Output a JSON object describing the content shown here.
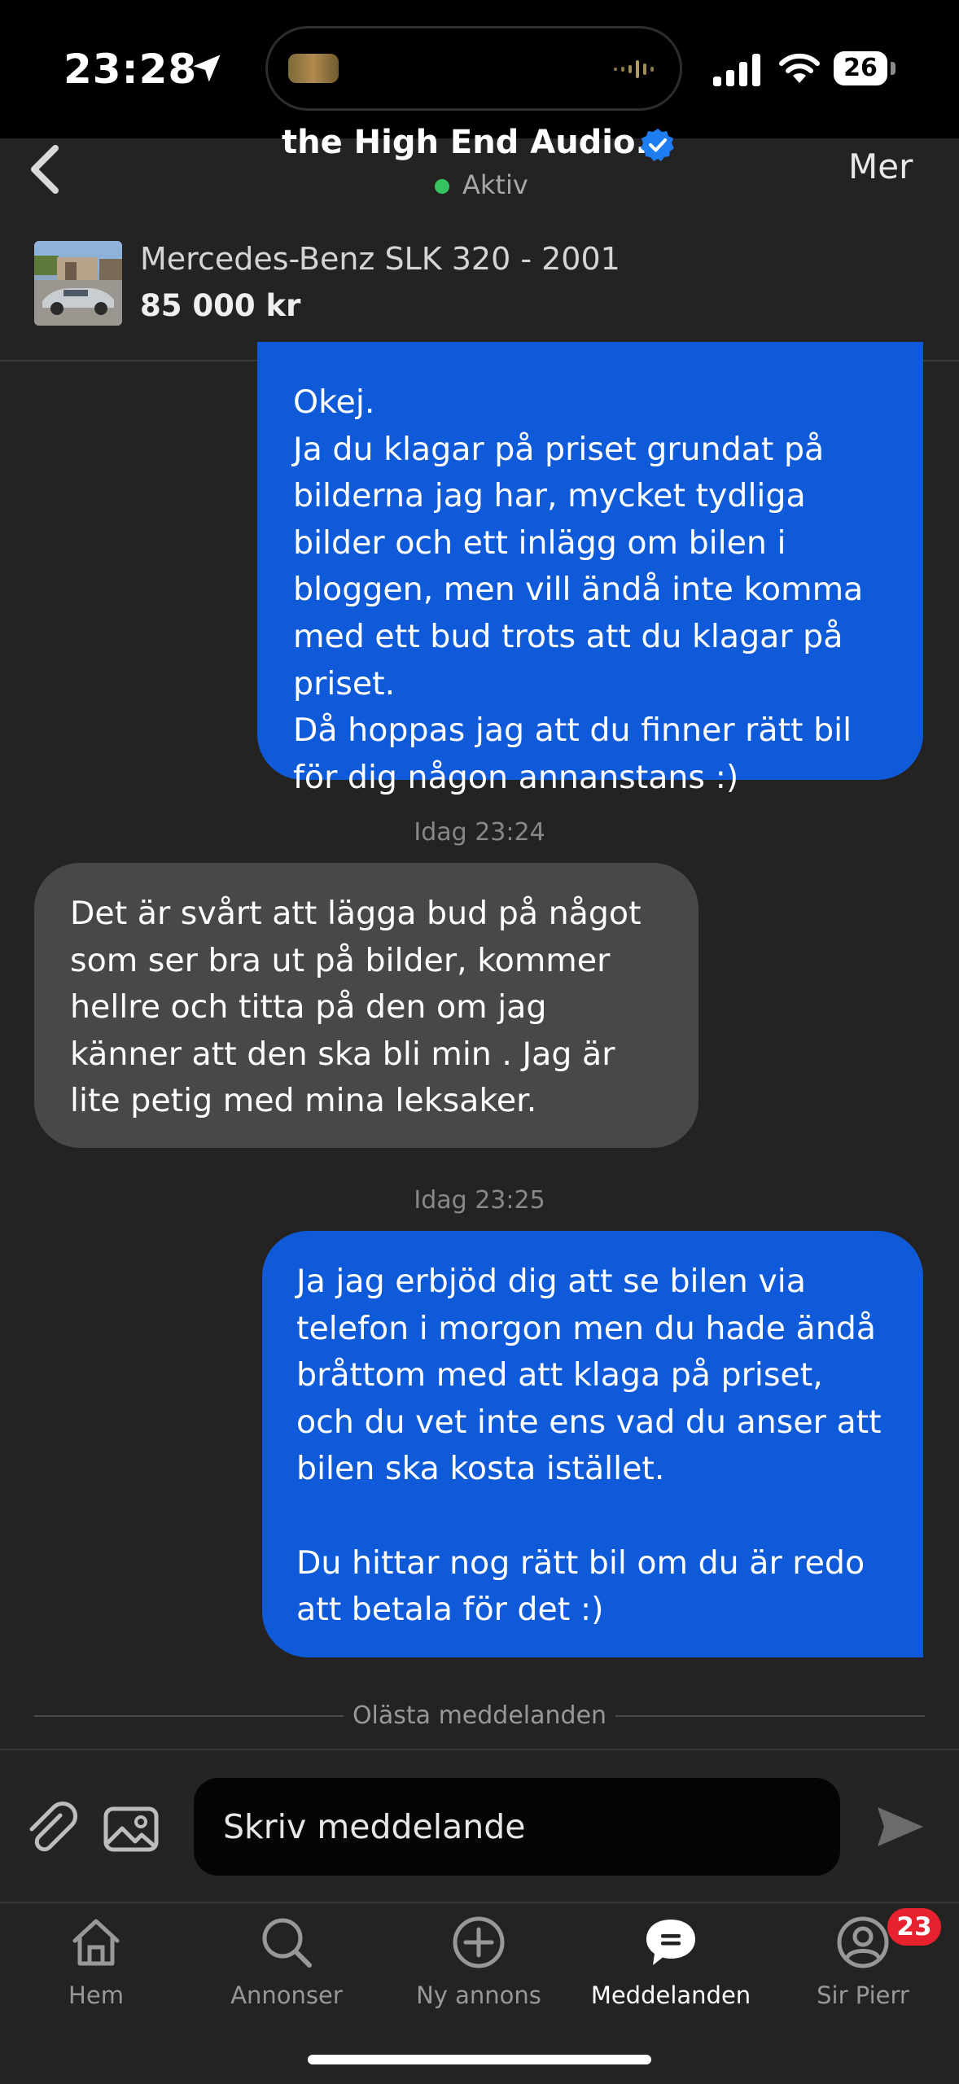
{
  "status_bar": {
    "time": "23:28",
    "battery": "26"
  },
  "header": {
    "title": "the High End Audio...",
    "status": "Aktiv",
    "more": "Mer",
    "accent": "#0f5ad8",
    "online_color": "#35c25f"
  },
  "listing": {
    "title": "Mercedes-Benz SLK 320 - 2001",
    "price": "85 000 kr"
  },
  "messages": [
    {
      "direction": "outgoing",
      "text": "Okej.\nJa du klagar på priset grundat på bilderna jag har, mycket tydliga bilder och ett inlägg om bilen i bloggen, men vill ändå inte komma med ett bud trots att du klagar på priset.\nDå hoppas jag att du finner rätt bil för dig någon annanstans :)"
    },
    {
      "direction": "incoming",
      "timestamp": "Idag 23:24",
      "text": "Det är svårt att lägga bud på något som ser bra ut på bilder, kommer hellre och titta på den om jag känner att den ska bli min . Jag är lite petig med mina leksaker."
    },
    {
      "direction": "outgoing",
      "timestamp": "Idag 23:25",
      "text": "Ja jag erbjöd dig att se bilen via telefon i morgon men du hade ändå bråttom med att klaga på priset, och du vet inte ens vad du anser att bilen ska kosta istället.\n\nDu hittar nog rätt bil om du är redo att betala för det :)"
    }
  ],
  "unread_divider": "Olästa meddelanden",
  "composer": {
    "placeholder": "Skriv meddelande"
  },
  "tabs": [
    {
      "label": "Hem",
      "icon": "home-icon"
    },
    {
      "label": "Annonser",
      "icon": "search-icon"
    },
    {
      "label": "Ny annons",
      "icon": "plus-circle-icon"
    },
    {
      "label": "Meddelanden",
      "icon": "chat-icon",
      "active": true
    },
    {
      "label": "Sir Pierr",
      "icon": "profile-icon",
      "badge": "23"
    }
  ]
}
